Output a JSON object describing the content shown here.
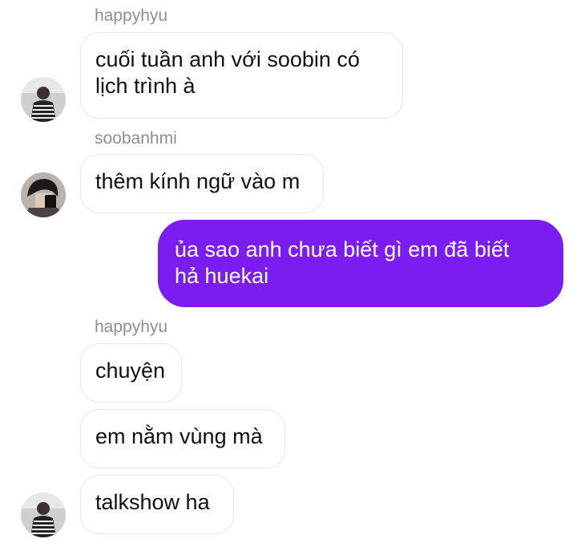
{
  "chat": {
    "messages": [
      {
        "sender": "happyhyu",
        "text": "cuối tuần anh với soobin có\nlịch trình à"
      },
      {
        "sender": "soobanhmi",
        "text": "thêm kính ngữ vào m"
      },
      {
        "sender": "me",
        "text": "ủa sao anh chưa biết gì em đã biết\nhả huekai"
      },
      {
        "sender": "happyhyu",
        "text": "chuyện"
      },
      {
        "sender": "happyhyu",
        "text": "em nằm vùng mà"
      },
      {
        "sender": "happyhyu",
        "text": "talkshow ha"
      }
    ],
    "sender_labels": [
      "happyhyu",
      "soobanhmi",
      "happyhyu"
    ],
    "accent_color": "#7b1cf0"
  }
}
